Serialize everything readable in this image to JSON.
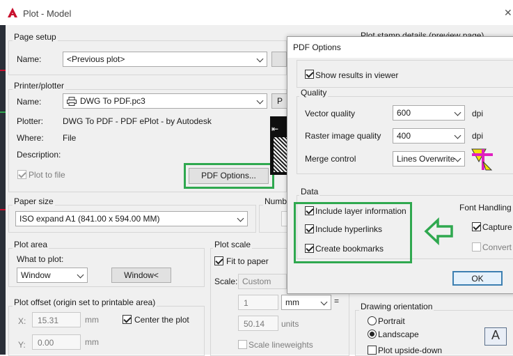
{
  "window": {
    "title": "Plot - Model",
    "close_glyph": "✕"
  },
  "page_setup": {
    "label": "Page setup",
    "name_label": "Name:",
    "name_value": "<Previous plot>"
  },
  "behind_title": "Plot stamp details (preview page)",
  "printer": {
    "label": "Printer/plotter",
    "name_label": "Name:",
    "name_value": "DWG To PDF.pc3",
    "plotter_label": "Plotter:",
    "plotter_value": "DWG To PDF - PDF ePlot - by Autodesk",
    "where_label": "Where:",
    "where_value": "File",
    "description_label": "Description:",
    "plot_to_file_label": "Plot to file",
    "pdf_options_button": "PDF Options...",
    "properties_button": "P"
  },
  "paper_size": {
    "label": "Paper size",
    "value": "ISO expand A1 (841.00 x 594.00 MM)"
  },
  "copies": {
    "label": "Number"
  },
  "plot_area": {
    "label": "Plot area",
    "what_label": "What to plot:",
    "what_value": "Window",
    "window_button": "Window<"
  },
  "plot_offset": {
    "label": "Plot offset (origin set to printable area)",
    "x_label": "X:",
    "x_value": "15.31",
    "x_unit": "mm",
    "y_label": "Y:",
    "y_value": "0.00",
    "y_unit": "mm",
    "center_label": "Center the plot"
  },
  "plot_scale": {
    "label": "Plot scale",
    "fit_label": "Fit to paper",
    "scale_label": "Scale:",
    "scale_value": "Custom",
    "num_value": "1",
    "unit_value": "mm",
    "equals": "=",
    "den_value": "50.14",
    "den_unit": "units",
    "lineweights_label": "Scale lineweights"
  },
  "drawing_orientation": {
    "label": "Drawing orientation",
    "portrait_label": "Portrait",
    "landscape_label": "Landscape",
    "upside_label": "Plot upside-down",
    "preview_letter": "A"
  },
  "pdf_options": {
    "title": "PDF Options",
    "show_results_label": "Show results in viewer",
    "quality_label": "Quality",
    "vector_label": "Vector quality",
    "vector_value": "600",
    "vector_unit": "dpi",
    "raster_label": "Raster image quality",
    "raster_value": "400",
    "raster_unit": "dpi",
    "merge_label": "Merge control",
    "merge_value": "Lines Overwrite",
    "data_label": "Data",
    "layer_label": "Include layer information",
    "hyperlinks_label": "Include hyperlinks",
    "bookmarks_label": "Create bookmarks",
    "font_handling_label": "Font Handling",
    "capture_label": "Capture f",
    "convert_label": "Convert a",
    "ok_label": "OK"
  },
  "colors": {
    "highlight": "#2fa84f",
    "autocad_red": "#c8102e"
  },
  "icons": {
    "app": "autocad-logo-icon",
    "printer": "printer-icon",
    "arrow": "left-arrow-icon",
    "merge": "merge-control-icon"
  }
}
